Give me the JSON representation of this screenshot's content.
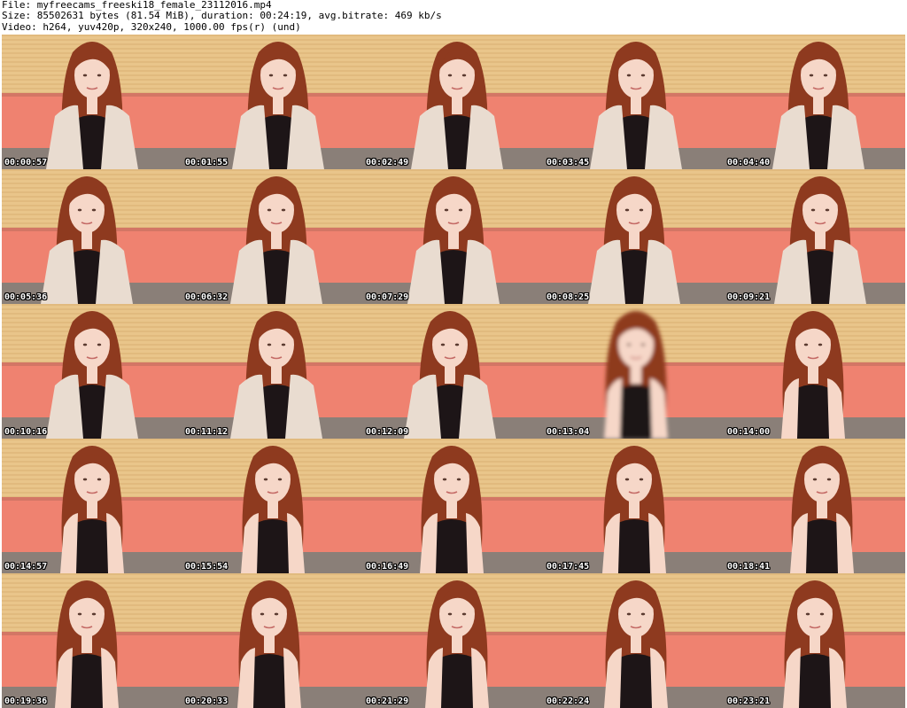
{
  "header": {
    "file_line": "File: myfreecams_freeski18_female_23112016.mp4",
    "size_line": "Size: 85502631 bytes (81.54 MiB), duration: 00:24:19, avg.bitrate: 469 kb/s",
    "video_line": "Video: h264, yuv420p, 320x240, 1000.00 fps(r) (und)"
  },
  "colors": {
    "wall": "#e9c58a",
    "wall_stripe": "#d7ad6e",
    "sofa": "#ef8270",
    "sofa_dark": "#b76a5a",
    "seat": "#8a7f78",
    "hair": "#8e3a1f",
    "skin": "#f6d7c8",
    "top": "#1d1517",
    "cardigan": "#e9dcd0"
  },
  "thumbnails": [
    {
      "timestamp": "00:00:57",
      "cardigan": true,
      "lean": 0,
      "blur": false
    },
    {
      "timestamp": "00:01:55",
      "cardigan": true,
      "lean": 6,
      "blur": false
    },
    {
      "timestamp": "00:02:49",
      "cardigan": true,
      "lean": 4,
      "blur": false
    },
    {
      "timestamp": "00:03:45",
      "cardigan": true,
      "lean": 2,
      "blur": false
    },
    {
      "timestamp": "00:04:40",
      "cardigan": true,
      "lean": 4,
      "blur": false
    },
    {
      "timestamp": "00:05:36",
      "cardigan": true,
      "lean": -6,
      "blur": false
    },
    {
      "timestamp": "00:06:32",
      "cardigan": true,
      "lean": 4,
      "blur": false
    },
    {
      "timestamp": "00:07:29",
      "cardigan": true,
      "lean": 0,
      "blur": false
    },
    {
      "timestamp": "00:08:25",
      "cardigan": true,
      "lean": 0,
      "blur": false
    },
    {
      "timestamp": "00:09:21",
      "cardigan": true,
      "lean": 6,
      "blur": false
    },
    {
      "timestamp": "00:10:16",
      "cardigan": true,
      "lean": 0,
      "blur": false
    },
    {
      "timestamp": "00:11:12",
      "cardigan": true,
      "lean": 4,
      "blur": false
    },
    {
      "timestamp": "00:12:09",
      "cardigan": true,
      "lean": -4,
      "blur": false
    },
    {
      "timestamp": "00:13:04",
      "cardigan": false,
      "lean": 2,
      "blur": true
    },
    {
      "timestamp": "00:14:00",
      "cardigan": false,
      "lean": -2,
      "blur": false
    },
    {
      "timestamp": "00:14:57",
      "cardigan": false,
      "lean": 0,
      "blur": false
    },
    {
      "timestamp": "00:15:54",
      "cardigan": false,
      "lean": 0,
      "blur": false
    },
    {
      "timestamp": "00:16:49",
      "cardigan": false,
      "lean": -2,
      "blur": false
    },
    {
      "timestamp": "00:17:45",
      "cardigan": false,
      "lean": 0,
      "blur": false
    },
    {
      "timestamp": "00:18:41",
      "cardigan": false,
      "lean": 8,
      "blur": false
    },
    {
      "timestamp": "00:19:36",
      "cardigan": false,
      "lean": -6,
      "blur": false
    },
    {
      "timestamp": "00:20:33",
      "cardigan": false,
      "lean": -4,
      "blur": false
    },
    {
      "timestamp": "00:21:29",
      "cardigan": false,
      "lean": 4,
      "blur": false
    },
    {
      "timestamp": "00:22:24",
      "cardigan": false,
      "lean": 2,
      "blur": false
    },
    {
      "timestamp": "00:23:21",
      "cardigan": false,
      "lean": 0,
      "blur": false
    }
  ]
}
